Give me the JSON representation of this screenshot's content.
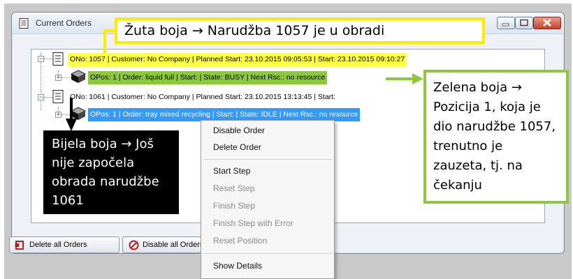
{
  "window": {
    "title": "Current Orders"
  },
  "tree": {
    "orders": [
      {
        "label": "ONo: 1057 | Customer: No Company | Planned Start: 23.10.2015 09:05:53 | Start: 23.10.2015 09:10:27",
        "color": "#ffff44",
        "position": "OPos: 1 | Order: liquid full | Start:  | State: BUSY |  Next Rsc.: no resource",
        "position_color": "#8dc73f"
      },
      {
        "label": "ONo: 1061 | Customer: No Company | Planned Start: 23.10.2015 13:13:45 | Start:",
        "color": "#ffffff",
        "position": "OPos: 1 | Order: tray mixed recycling | Start:  | State: IDLE |  Next Rsc.: no resource",
        "position_color": "#3399ff"
      }
    ]
  },
  "buttons": {
    "delete_all": "Delete all Orders",
    "disable_all": "Disable all Orders"
  },
  "context_menu": {
    "items": [
      {
        "label": "Disable Order",
        "enabled": true
      },
      {
        "label": "Delete Order",
        "enabled": true
      },
      {
        "label": "Start Step",
        "enabled": true
      },
      {
        "label": "Reset Step",
        "enabled": false
      },
      {
        "label": "Finish Step",
        "enabled": false
      },
      {
        "label": "Finish Step with Error",
        "enabled": false
      },
      {
        "label": "Reset Position",
        "enabled": false
      },
      {
        "label": "Show Details",
        "enabled": true
      }
    ]
  },
  "annotations": {
    "yellow": "Žuta boja → Narudžba 1057 je u obradi",
    "green": "Zelena boja → Pozicija 1, koja je dio narudžbe 1057, trenutno je zauzeta, tj. na čekanju",
    "black": "Bijela boja → Još nije započela obrada narudžbe 1061"
  },
  "colors": {
    "yellow_highlight": "#ffff44",
    "green_highlight": "#8dc73f",
    "selection_blue": "#3399ff",
    "callout_yellow": "#ffea00",
    "callout_green": "#8dc73f"
  }
}
